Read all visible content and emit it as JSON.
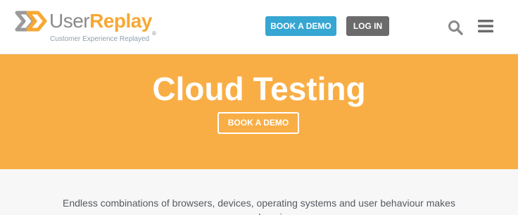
{
  "brand": {
    "word_plain": "User",
    "word_accent": "Replay",
    "registered": "®",
    "tagline": "Customer Experience Replayed"
  },
  "header": {
    "book_demo_label": "BOOK A DEMO",
    "login_label": "LOG IN",
    "icons": [
      "search-icon",
      "menu-icon"
    ]
  },
  "hero": {
    "title": "Cloud Testing",
    "cta_label": "BOOK A DEMO",
    "background_color": "#f9ae45"
  },
  "content": {
    "intro_text": "Endless combinations of browsers, devices, operating systems and user behaviour makes comprehensive"
  },
  "colors": {
    "demo_button": "#36a6d3",
    "login_button": "#6b6b6b",
    "brand_orange": "#f7a833"
  }
}
